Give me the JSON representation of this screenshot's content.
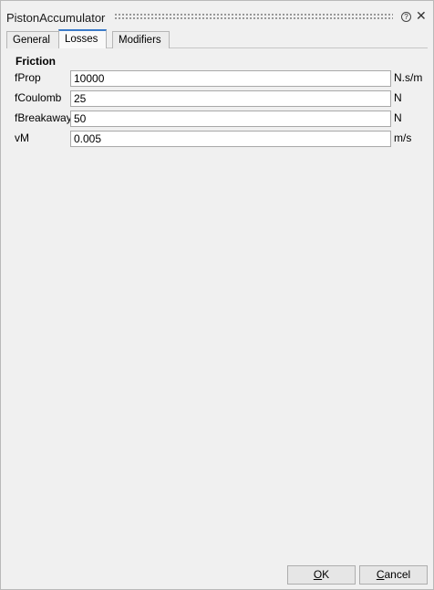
{
  "window": {
    "title": "PistonAccumulator"
  },
  "titlebar": {
    "help_glyph": "?",
    "close_glyph": "✕"
  },
  "tabs": [
    {
      "label": "General",
      "active": false
    },
    {
      "label": "Losses",
      "active": true
    },
    {
      "label": "Modifiers",
      "active": false
    }
  ],
  "group": {
    "title": "Friction"
  },
  "params": [
    {
      "name": "fProp",
      "value": "10000",
      "unit": "N.s/m"
    },
    {
      "name": "fCoulomb",
      "value": "25",
      "unit": "N"
    },
    {
      "name": "fBreakaway",
      "value": "50",
      "unit": "N"
    },
    {
      "name": "vM",
      "value": "0.005",
      "unit": "m/s"
    }
  ],
  "buttons": {
    "ok": {
      "mnemonic": "O",
      "rest": "K"
    },
    "cancel": {
      "mnemonic": "C",
      "rest": "ancel"
    }
  },
  "colors": {
    "accent_tab": "#3b7bc8",
    "background": "#f0f0f0"
  }
}
